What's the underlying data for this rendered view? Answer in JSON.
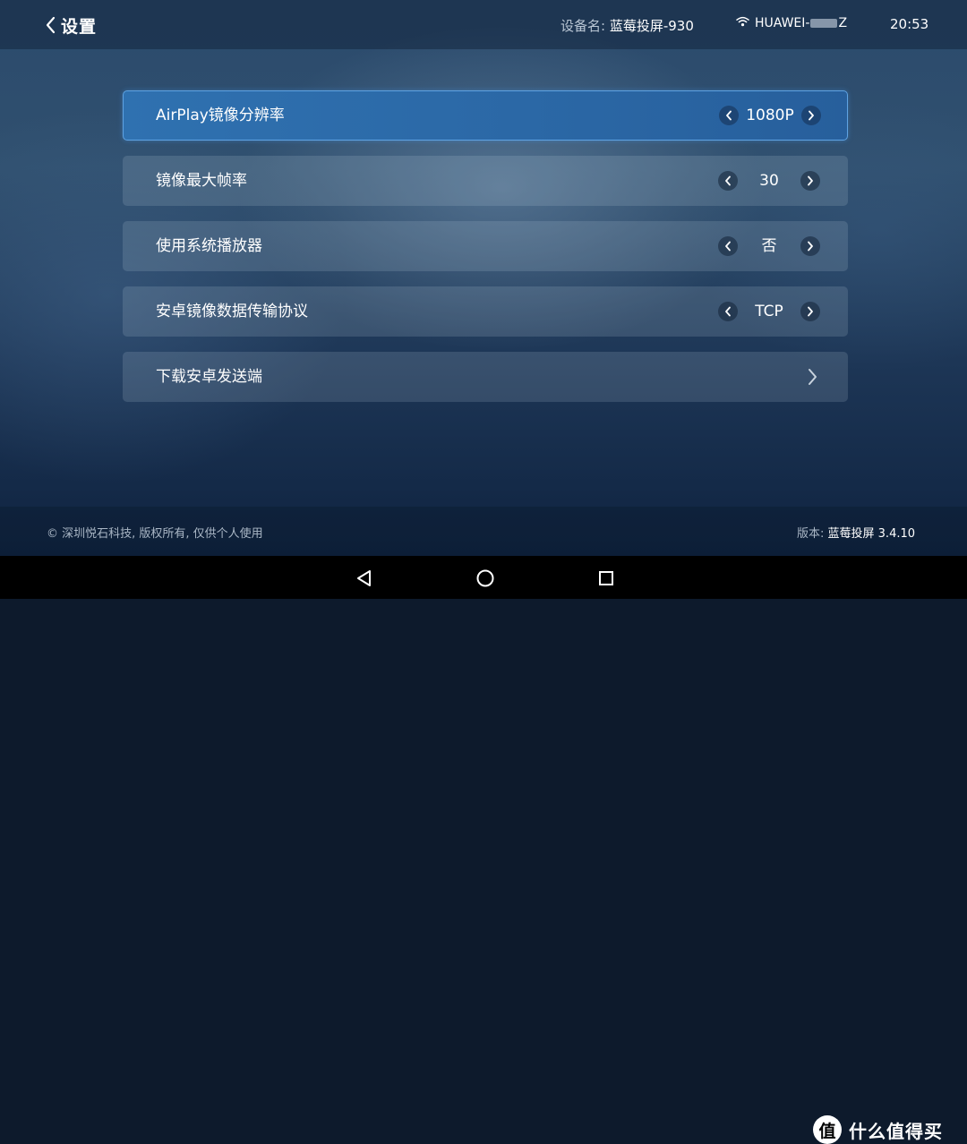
{
  "header": {
    "title": "设置",
    "device_label": "设备名:",
    "device_name": "蓝莓投屏-930",
    "wifi_prefix": "HUAWEI-",
    "wifi_suffix": "Z",
    "time": "20:53"
  },
  "settings": [
    {
      "label": "AirPlay镜像分辨率",
      "value": "1080P",
      "selected": true
    },
    {
      "label": "镜像最大帧率",
      "value": "30",
      "selected": false
    },
    {
      "label": "使用系统播放器",
      "value": "否",
      "selected": false
    },
    {
      "label": "安卓镜像数据传输协议",
      "value": "TCP",
      "selected": false
    },
    {
      "label": "下载安卓发送端",
      "value": "",
      "selected": false
    }
  ],
  "footer": {
    "copyright": "© 深圳悦石科技, 版权所有, 仅供个人使用",
    "version_label": "版本:",
    "version_value": "蓝莓投屏 3.4.10"
  },
  "watermark": {
    "logo_char": "值",
    "text": "什么值得买"
  },
  "icons": {
    "back": "chevron-left-icon",
    "wifi": "wifi-icon",
    "nav_back": "triangle-back-icon",
    "nav_home": "circle-home-icon",
    "nav_recent": "square-recent-icon"
  },
  "colors": {
    "selected_row": "#2f71b0",
    "selected_border": "#5fa3e3"
  }
}
